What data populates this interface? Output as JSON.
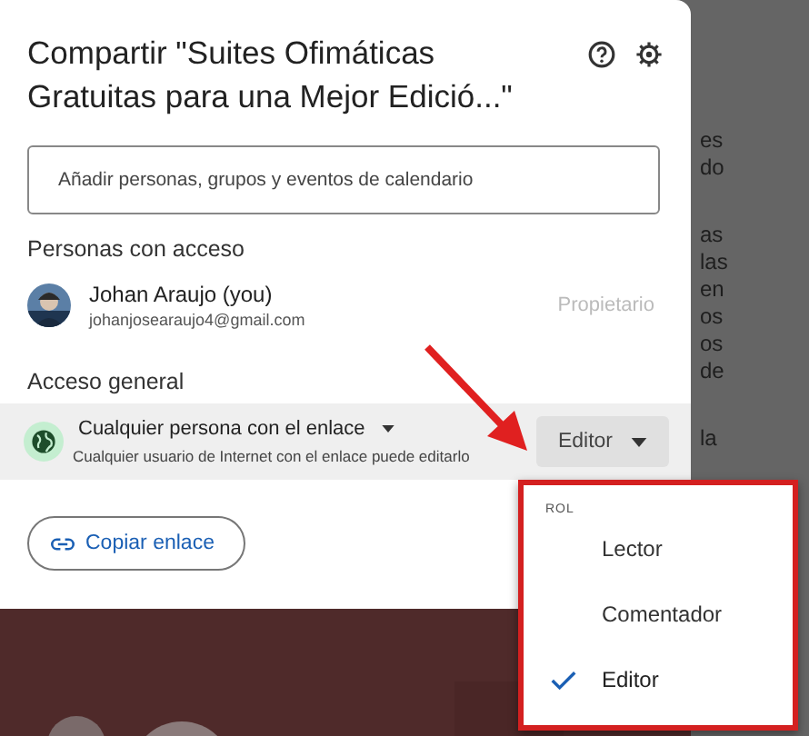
{
  "dialog": {
    "title": "Compartir \"Suites Ofimáticas Gratuitas para una Mejor Edició...\"",
    "search": {
      "placeholder": "Añadir personas, grupos y eventos de calendario"
    },
    "people_heading": "Personas con acceso",
    "people": [
      {
        "name": "Johan Araujo (you)",
        "email": "johanjosearaujo4@gmail.com",
        "role": "Propietario"
      }
    ],
    "general_heading": "Acceso general",
    "general": {
      "access": "Cualquier persona con el enlace",
      "description": "Cualquier usuario de Internet con el enlace puede editarlo",
      "role": "Editor"
    },
    "copy_link": "Copiar enlace"
  },
  "role_menu": {
    "heading": "ROL",
    "items": [
      {
        "label": "Lector",
        "selected": false
      },
      {
        "label": "Comentador",
        "selected": false
      },
      {
        "label": "Editor",
        "selected": true
      }
    ]
  },
  "background_text": [
    [
      "es",
      "do"
    ],
    [
      "as",
      "las",
      "en",
      "os",
      "os",
      "de"
    ],
    [
      "la"
    ]
  ]
}
